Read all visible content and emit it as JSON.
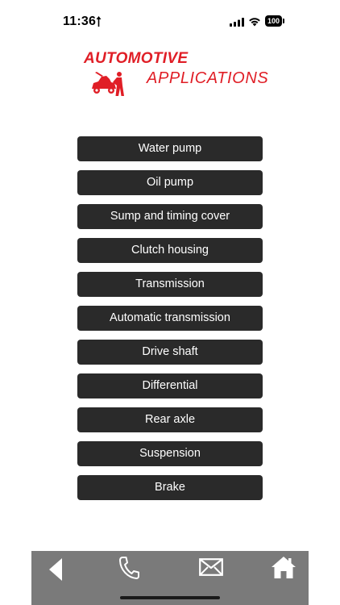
{
  "status_bar": {
    "time": "11:36",
    "battery": "100"
  },
  "logo": {
    "line1": "AUTOMOTIVE",
    "line2": "APPLICATIONS"
  },
  "menu": {
    "items": [
      {
        "label": "Water pump"
      },
      {
        "label": "Oil pump"
      },
      {
        "label": "Sump and timing cover"
      },
      {
        "label": "Clutch housing"
      },
      {
        "label": "Transmission"
      },
      {
        "label": "Automatic transmission"
      },
      {
        "label": "Drive shaft"
      },
      {
        "label": "Differential"
      },
      {
        "label": "Rear axle"
      },
      {
        "label": "Suspension"
      },
      {
        "label": "Brake"
      }
    ]
  },
  "bottom_bar": {
    "icons": [
      "back-icon",
      "phone-icon",
      "mail-icon",
      "home-icon"
    ]
  },
  "colors": {
    "brand_red": "#e01e26",
    "button_bg": "#2a2a2a",
    "bottom_bar_bg": "#7a7a7a"
  }
}
